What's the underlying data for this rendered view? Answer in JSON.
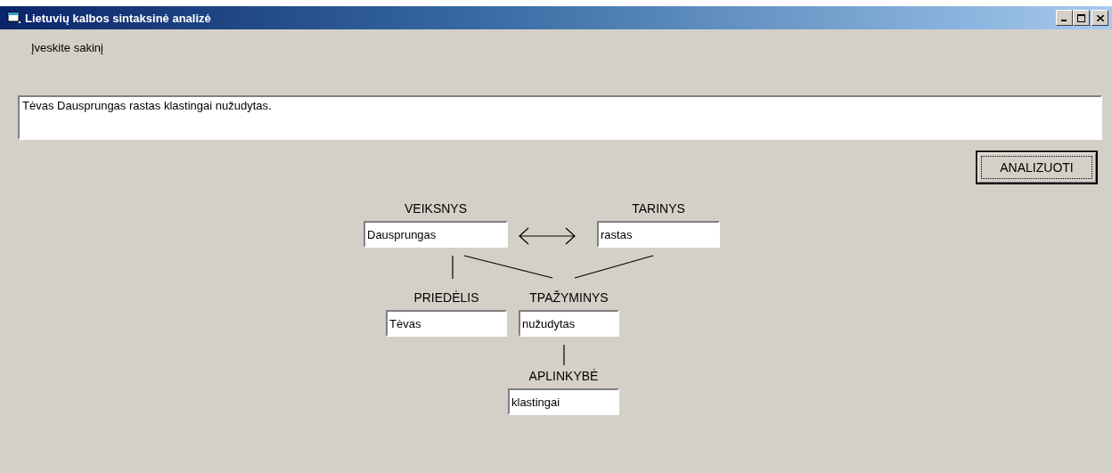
{
  "window": {
    "title": "Lietuvių kalbos sintaksinė analizė"
  },
  "prompt": "Įveskite sakinį",
  "sentence": {
    "value": "Tėvas Dausprungas rastas klastingai nužudytas."
  },
  "analyze_button": "ANALIZUOTI",
  "nodes": [
    {
      "label": "VEIKSNYS",
      "value": "Dausprungas"
    },
    {
      "label": "TARINYS",
      "value": "rastas"
    },
    {
      "label": "PRIEDĖLIS",
      "value": "Tėvas"
    },
    {
      "label": "TPAŽYMINYS",
      "value": "nužudytas"
    },
    {
      "label": "APLINKYBĖ",
      "value": "klastingai"
    }
  ]
}
